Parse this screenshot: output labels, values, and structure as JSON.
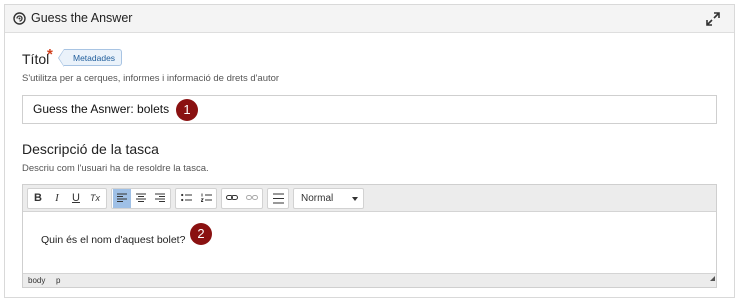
{
  "header": {
    "title": "Guess the Answer",
    "icon": "h5p-logo-icon",
    "expand_icon": "expand-icon"
  },
  "title_field": {
    "label": "Títol",
    "required_mark": "*",
    "meta_tag": "Metadades",
    "help": "S'utilitza per a cerques, informes i informació de drets d'autor",
    "value": "Guess the Asnwer: bolets",
    "badge": "1"
  },
  "description_field": {
    "label": "Descripció de la tasca",
    "help": "Descriu com l'usuari ha de resoldre la tasca.",
    "toolbar": {
      "bold": "B",
      "italic": "I",
      "underline": "U",
      "clear_format": "Tx",
      "format_value": "Normal"
    },
    "content": "Quin és el nom d'aquest bolet?",
    "badge": "2",
    "path": [
      "body",
      "p"
    ]
  },
  "colors": {
    "badge": "#8a1111",
    "required": "#d13f1c",
    "active_button": "#9fc0e6"
  }
}
